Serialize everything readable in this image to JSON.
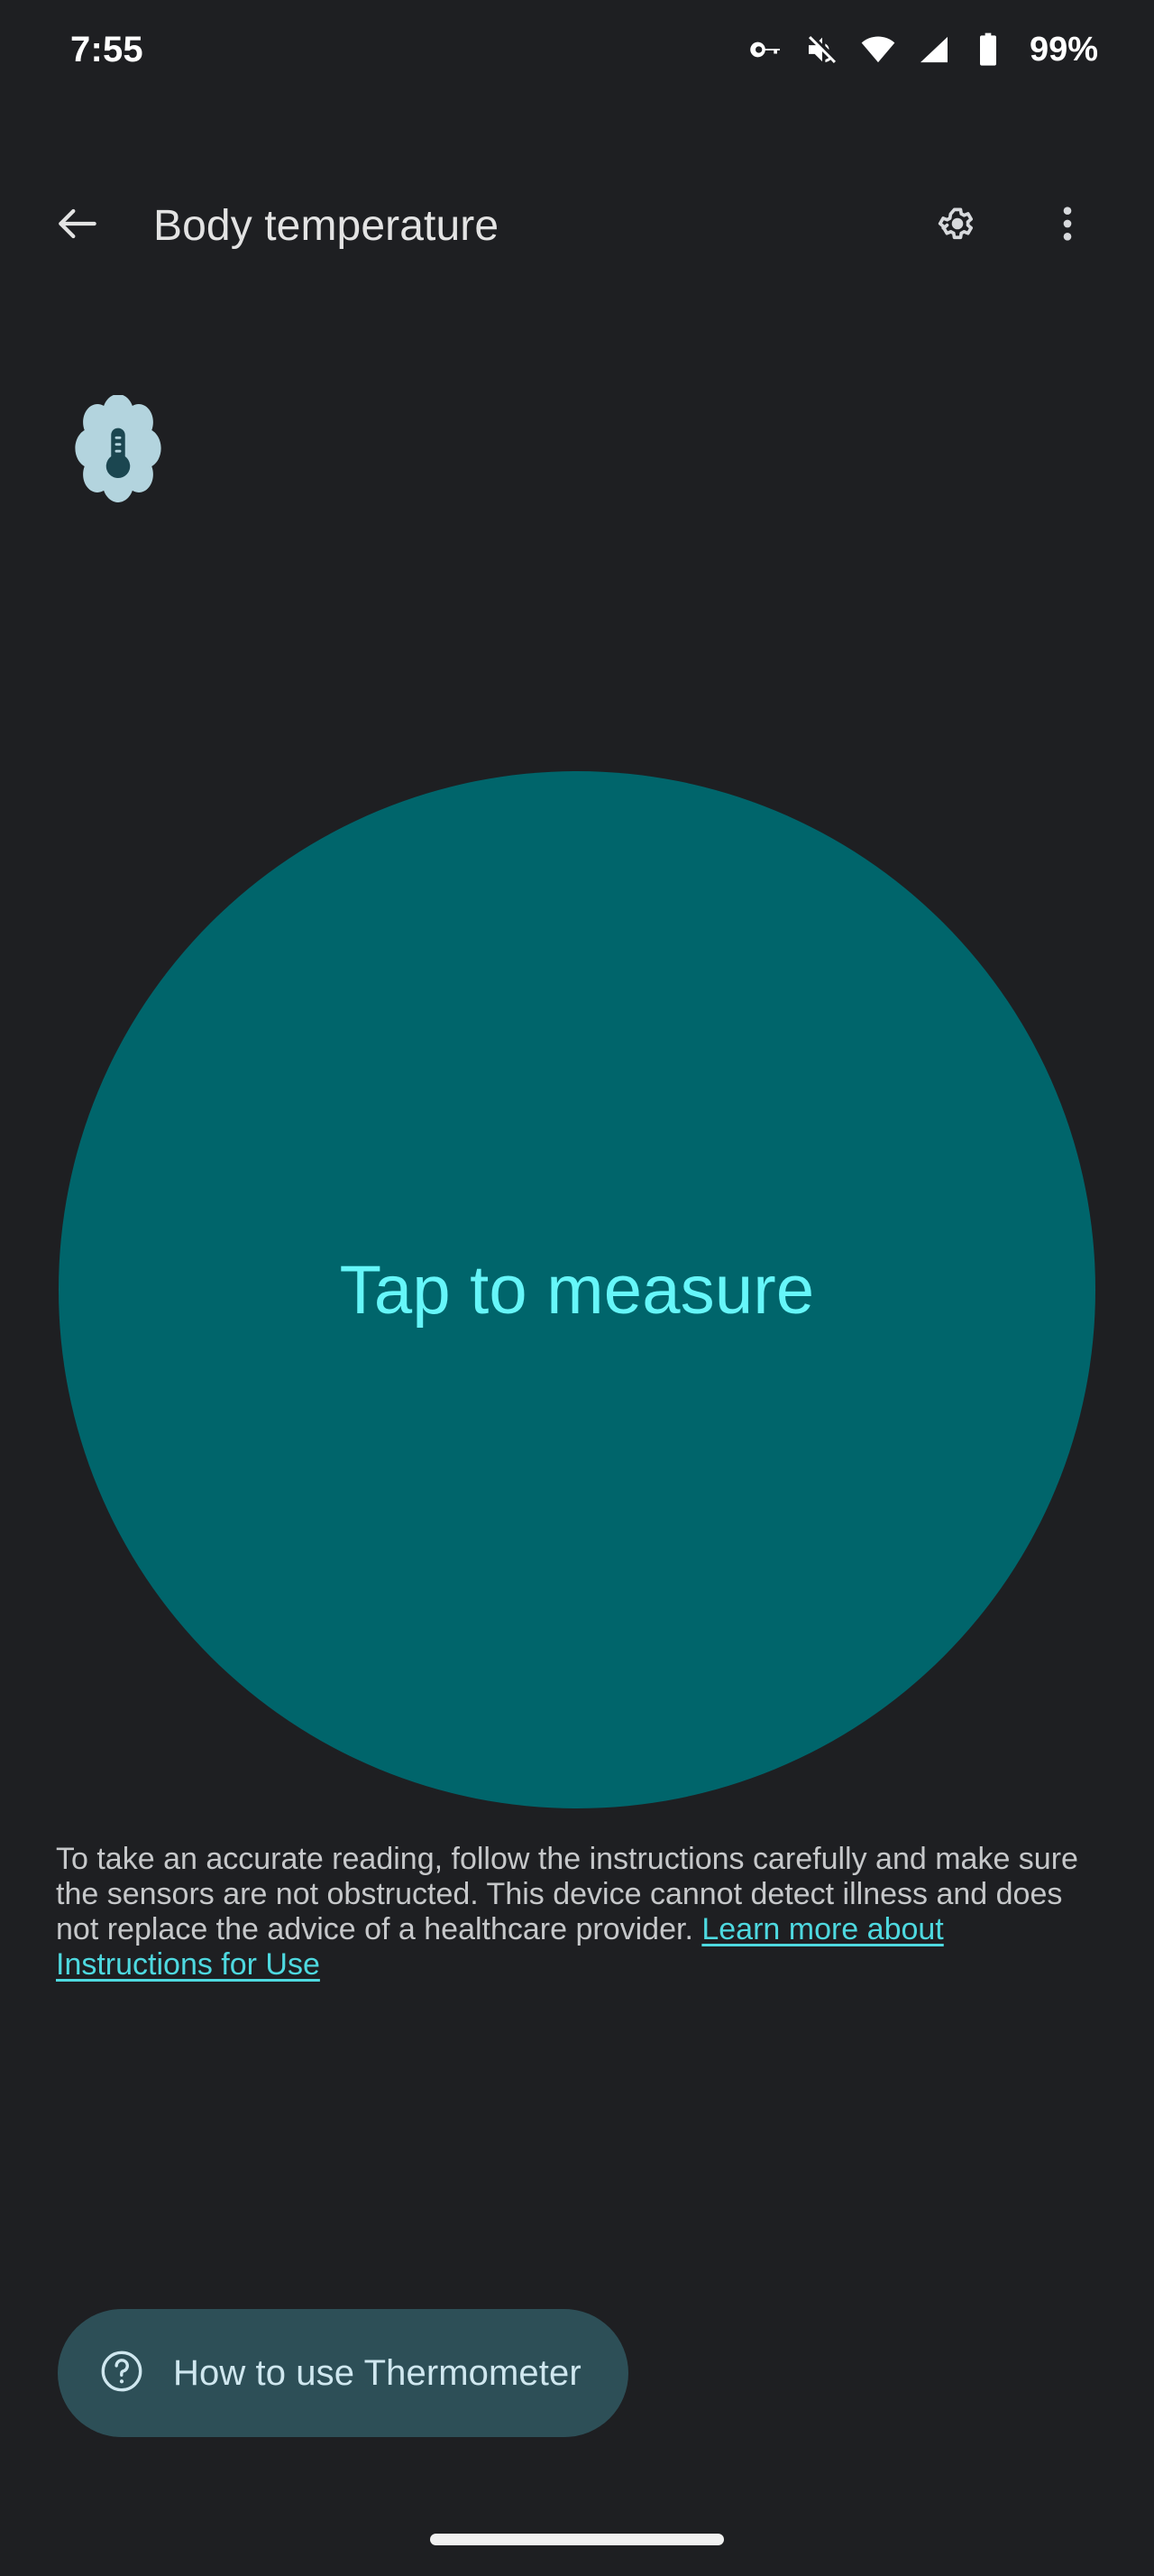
{
  "status_bar": {
    "time": "7:55",
    "battery_percent": "99%",
    "icons": [
      "vpn-key-icon",
      "volume-muted-icon",
      "wifi-icon",
      "cell-signal-icon",
      "battery-icon"
    ]
  },
  "app_bar": {
    "back_label": "back-arrow-icon",
    "title": "Body temperature",
    "settings_label": "gear-icon",
    "overflow_label": "more-options-icon"
  },
  "hero": {
    "badge_icon": "thermometer-badge-icon",
    "measure_button_label": "Tap to measure"
  },
  "disclaimer": {
    "text": "To take an accurate reading, follow the instructions carefully and make sure the sensors are not obstructed. This device cannot detect illness and does not replace the advice of a healthcare provider. ",
    "link_text": "Learn more about Instructions for Use"
  },
  "bottom_action": {
    "icon": "help-circle-icon",
    "label": "How to use Thermometer"
  },
  "colors": {
    "background": "#1e1f22",
    "circle": "#00656b",
    "circle_text": "#66f6f9",
    "badge": "#b3d4de",
    "badge_glyph": "#1b4650",
    "button_bg": "#2d4f57",
    "button_text": "#cfe7ef",
    "link": "#4ed9e0",
    "body_text": "#c6c8ca",
    "title_text": "#e3e3e3"
  }
}
